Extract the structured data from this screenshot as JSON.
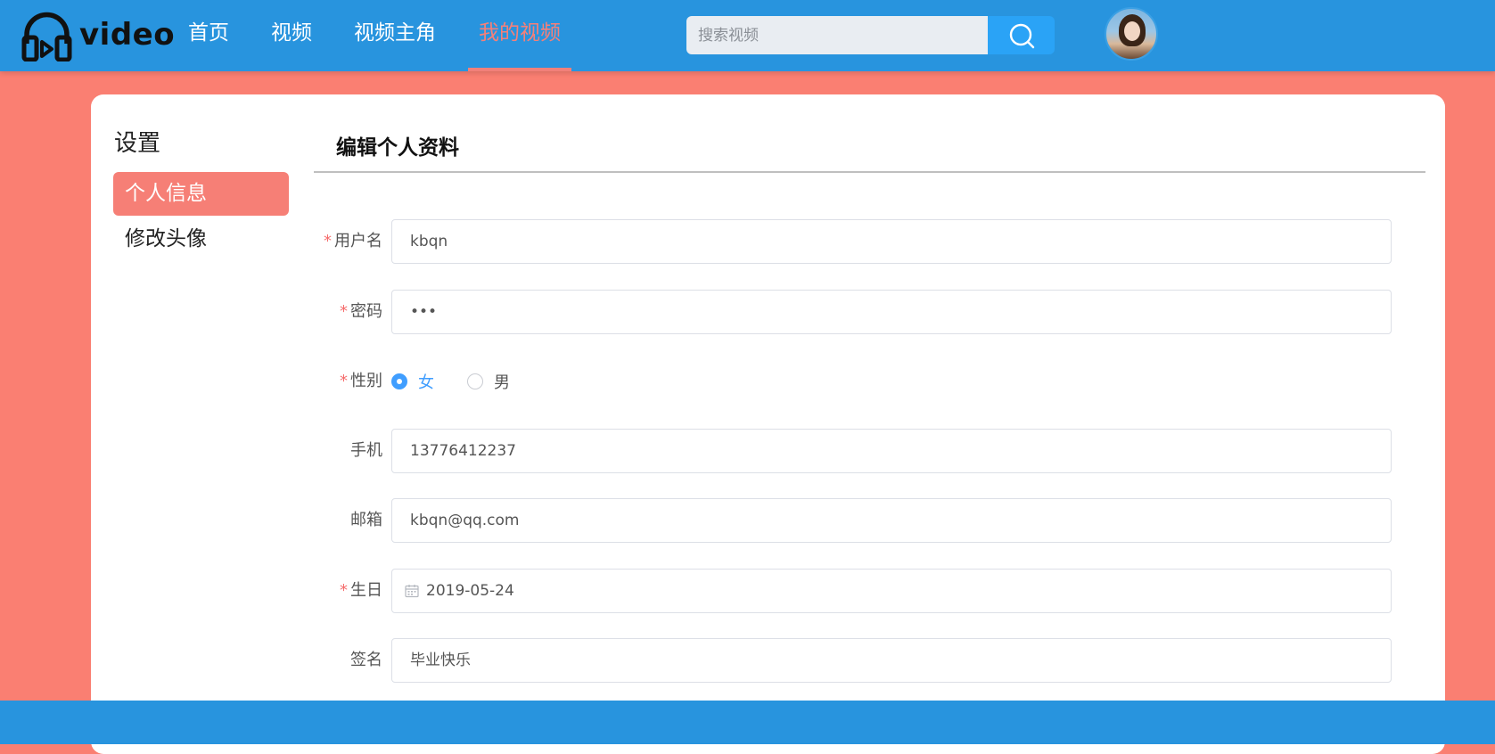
{
  "header": {
    "logo_text": "video",
    "nav": [
      {
        "label": "首页",
        "active": false
      },
      {
        "label": "视频",
        "active": false
      },
      {
        "label": "视频主角",
        "active": false
      },
      {
        "label": "我的视频",
        "active": true
      }
    ],
    "search": {
      "placeholder": "搜索视频",
      "value": ""
    }
  },
  "sidebar": {
    "title": "设置",
    "items": [
      {
        "label": "个人信息",
        "active": true
      },
      {
        "label": "修改头像",
        "active": false
      }
    ]
  },
  "form": {
    "title": "编辑个人资料",
    "required_mark": "*",
    "username": {
      "label": "用户名",
      "value": "kbqn"
    },
    "password": {
      "label": "密码",
      "value": "•••"
    },
    "gender": {
      "label": "性别",
      "options": [
        "女",
        "男"
      ],
      "selected": "女"
    },
    "phone": {
      "label": "手机",
      "value": "13776412237"
    },
    "email": {
      "label": "邮箱",
      "value": "kbqn@qq.com"
    },
    "birthday": {
      "label": "生日",
      "value": "2019-05-24"
    },
    "signature": {
      "label": "签名",
      "value": "毕业快乐"
    }
  },
  "colors": {
    "header_bg": "#2894de",
    "page_bg": "#fa7f72",
    "accent": "#f67f76",
    "radio_active": "#409eff",
    "search_button": "#2aa3f6"
  },
  "icons": [
    "headphones-logo-icon",
    "search-icon",
    "calendar-icon"
  ]
}
